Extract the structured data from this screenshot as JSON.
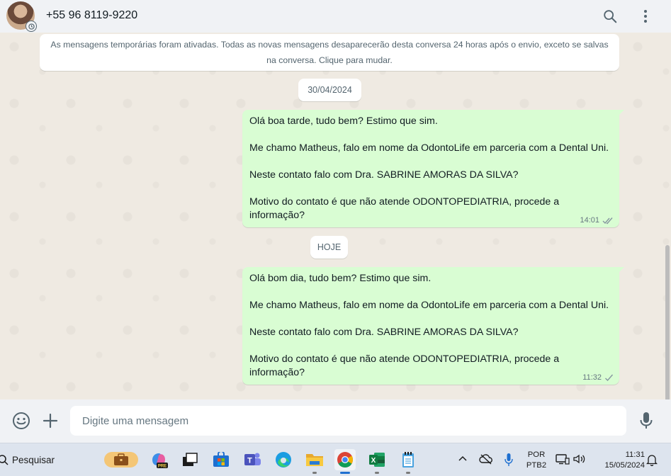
{
  "header": {
    "contact": "+55 96 8119-9220",
    "search_icon": "search-icon",
    "menu_icon": "kebab-menu-icon"
  },
  "chat": {
    "notice": "As mensagens temporárias foram ativadas. Todas as novas mensagens desaparecerão desta conversa 24 horas após o envio, exceto se salvas na conversa. Clique para mudar.",
    "date1": "30/04/2024",
    "message1": {
      "lines": [
        "Olá boa tarde, tudo bem? Estimo que sim.",
        "Me chamo Matheus, falo em nome da OdontoLife em parceria com a Dental Uni.",
        "Neste contato falo com Dra. SABRINE AMORAS DA SILVA?",
        "Motivo do contato é que não atende ODONTOPEDIATRIA, procede a informação?"
      ],
      "time": "14:01",
      "status": "double-check"
    },
    "date2": "HOJE",
    "message2": {
      "lines": [
        "Olá bom dia, tudo bem? Estimo que sim.",
        "Me chamo Matheus, falo em nome da OdontoLife em parceria com a Dental Uni.",
        "Neste contato falo com Dra. SABRINE AMORAS DA SILVA?",
        "Motivo do contato é que não atende ODONTOPEDIATRIA, procede a informação?"
      ],
      "time": "11:32",
      "status": "single-check"
    }
  },
  "composer": {
    "placeholder": "Digite uma mensagem"
  },
  "taskbar": {
    "search_label": "Pesquisar",
    "lang_top": "POR",
    "lang_bottom": "PTB2",
    "time": "11:31",
    "date": "15/05/2024"
  },
  "colors": {
    "bubble_out": "#d9fdd3",
    "chat_bg": "#efeae2",
    "header_bg": "#f0f2f5",
    "tick_blue_grey": "#8696a0"
  }
}
